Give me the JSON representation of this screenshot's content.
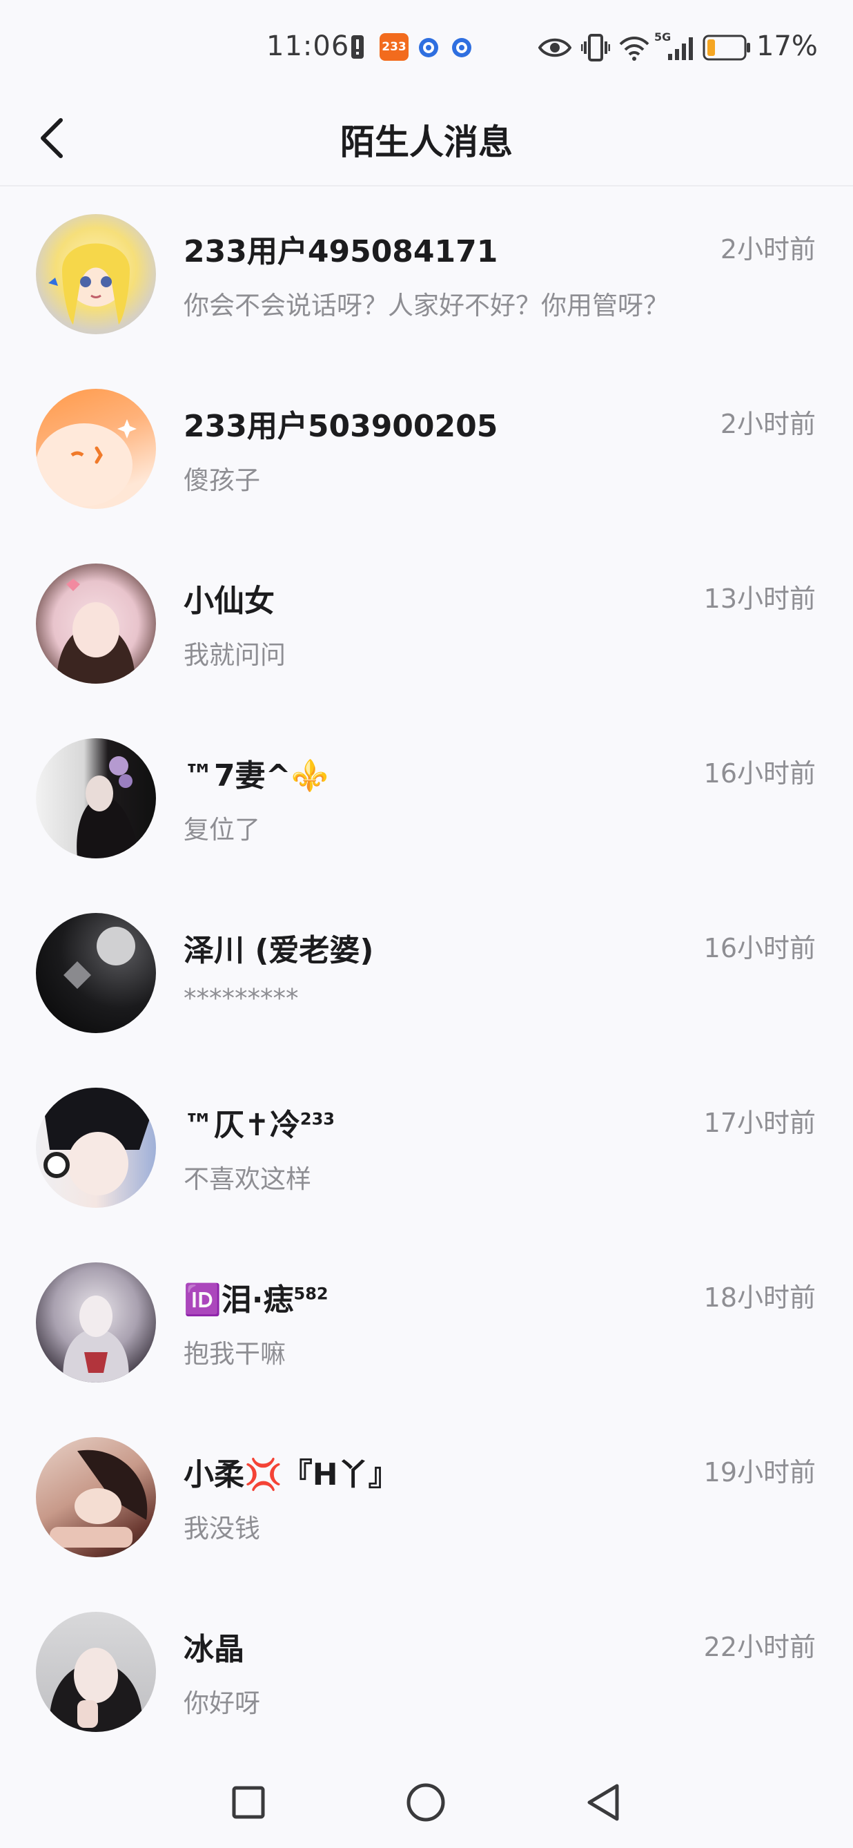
{
  "status_bar": {
    "time": "11:06",
    "app_badge": "233",
    "network": "5G",
    "battery": "17%"
  },
  "header": {
    "title": "陌生人消息"
  },
  "messages": [
    {
      "name": "233用户495084171",
      "sup": "",
      "time": "2小时前",
      "preview": "你会不会说话呀？人家好不好？你用管呀？"
    },
    {
      "name": "233用户503900205",
      "sup": "",
      "time": "2小时前",
      "preview": "傻孩子"
    },
    {
      "name": "小仙女",
      "sup": "",
      "time": "13小时前",
      "preview": "我就问问"
    },
    {
      "name": "™7妻^⚜️",
      "sup": "",
      "time": "16小时前",
      "preview": "复位了"
    },
    {
      "name": "泽川 (爱老婆)",
      "sup": "",
      "time": "16小时前",
      "preview": "*********"
    },
    {
      "name": "™仄✝冷",
      "sup": "233",
      "time": "17小时前",
      "preview": "不喜欢这样"
    },
    {
      "name": "🆔泪·痣",
      "sup": "582",
      "time": "18小时前",
      "preview": "抱我干嘛"
    },
    {
      "name": "小柔💢『H丫』",
      "sup": "",
      "time": "19小时前",
      "preview": "我没钱"
    },
    {
      "name": "冰晶",
      "sup": "",
      "time": "22小时前",
      "preview": "你好呀"
    }
  ],
  "icons": {
    "back": "chevron-left-icon",
    "nav_recent": "square-icon",
    "nav_home": "circle-icon",
    "nav_back": "triangle-back-icon"
  },
  "colors": {
    "background": "#f9f9fc",
    "title_text": "#1c1c1e",
    "secondary_text": "#8e8e93",
    "battery_low": "#f5a623",
    "badge_orange": "#f26b1d",
    "badge_blue": "#2f6fe0"
  }
}
